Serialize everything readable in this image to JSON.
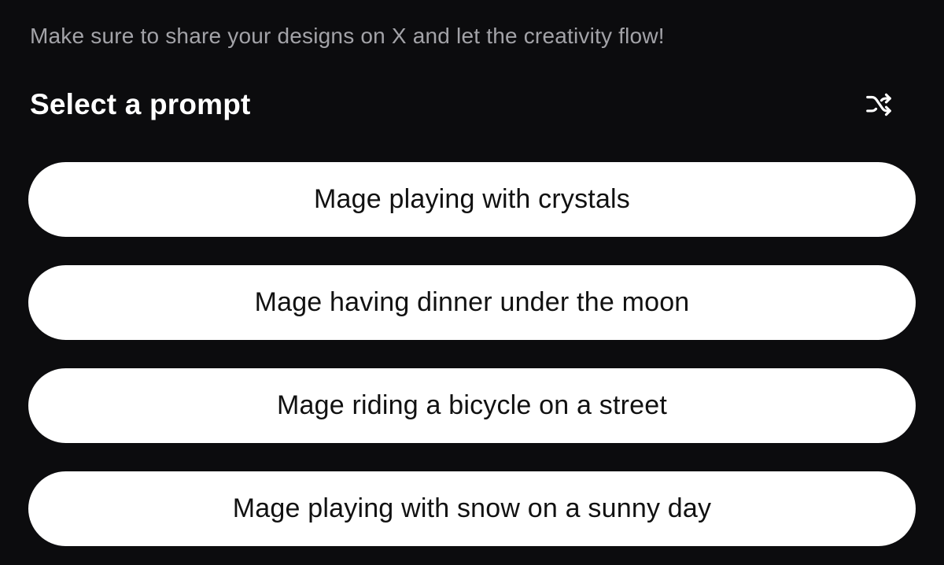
{
  "intro": {
    "text": "Make sure to share your designs on X and let the creativity flow!"
  },
  "header": {
    "title": "Select a prompt",
    "shuffle_icon": "shuffle-icon"
  },
  "prompts": [
    {
      "label": "Mage playing with crystals"
    },
    {
      "label": "Mage having dinner under the moon"
    },
    {
      "label": "Mage riding a bicycle on a street"
    },
    {
      "label": "Mage playing with snow on a sunny day"
    }
  ],
  "colors": {
    "background": "#0c0c0e",
    "intro_text": "#a3a3a8",
    "title_text": "#ffffff",
    "button_bg": "#ffffff",
    "button_text": "#111111"
  }
}
